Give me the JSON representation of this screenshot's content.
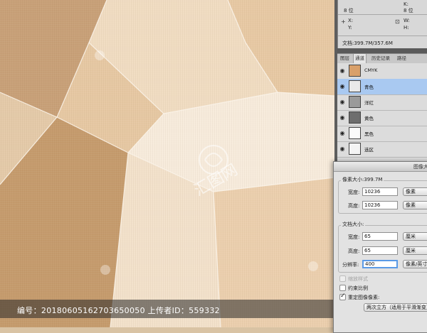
{
  "watermark": {
    "text": "编号：20180605162703650050 上传者ID：559332",
    "logo_text": "汇图网"
  },
  "info_panel": {
    "bits_left": "8 位",
    "bits_right": "8 位",
    "k_label": "K:",
    "x_label": "X:",
    "y_label": "Y:",
    "w_label": "W:",
    "h_label": "H:",
    "doc_size": "文档:399.7M/357.6M"
  },
  "channels_panel": {
    "tabs": [
      "图层",
      "通道",
      "历史记录",
      "路径"
    ],
    "active_tab": "通道",
    "channels": [
      {
        "label": "CMYK",
        "thumb": "#d9a06a"
      },
      {
        "label": "青色",
        "thumb": "#eaeaea",
        "selected": true
      },
      {
        "label": "洋红",
        "thumb": "#9a9a9a"
      },
      {
        "label": "黄色",
        "thumb": "#6e6e6e"
      },
      {
        "label": "黑色",
        "thumb": "#fbfbfb"
      },
      {
        "label": "选区",
        "thumb": "#f4f4f4"
      }
    ]
  },
  "dialog": {
    "title": "图像大",
    "pixel_dimensions": "像素大小:399.7M",
    "pixel_width_label": "宽度:",
    "pixel_width_value": "10236",
    "pixel_width_unit": "像素",
    "pixel_height_label": "高度:",
    "pixel_height_value": "10236",
    "pixel_height_unit": "像素",
    "document_size": "文档大小:",
    "doc_width_label": "宽度:",
    "doc_width_value": "65",
    "doc_width_unit": "厘米",
    "doc_height_label": "高度:",
    "doc_height_value": "65",
    "doc_height_unit": "厘米",
    "resolution_label": "分辨率:",
    "resolution_value": "400",
    "resolution_unit": "像素/英寸",
    "scale_styles": "缩放样式",
    "constrain_proportions": "约束比例",
    "resample_image": "重定图像像素:",
    "resample_method": "两次立方（适用于平滑渐变）"
  }
}
